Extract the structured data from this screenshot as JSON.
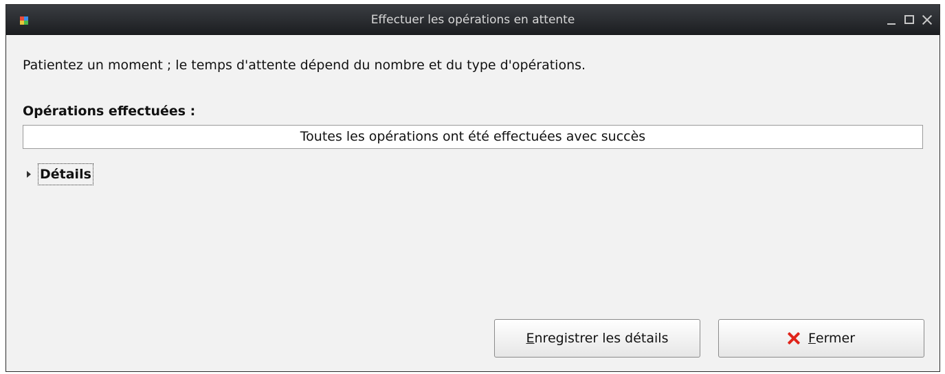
{
  "window": {
    "title": "Effectuer les opérations en attente",
    "icon": "application-icon",
    "controls": [
      "minimize-icon",
      "maximize-icon",
      "close-icon"
    ]
  },
  "body": {
    "message": "Patientez un moment ; le temps d'attente dépend du nombre et du type d'opérations.",
    "section_title": "Opérations effectuées :",
    "status_text": "Toutes les opérations ont été effectuées avec succès",
    "details_label": "Détails",
    "details_expanded": false
  },
  "buttons": {
    "save": {
      "mnemonic": "E",
      "rest": "nregistrer les détails"
    },
    "close": {
      "mnemonic": "F",
      "rest": "ermer",
      "icon": "close-x-icon",
      "icon_color": "#e0251b"
    }
  }
}
